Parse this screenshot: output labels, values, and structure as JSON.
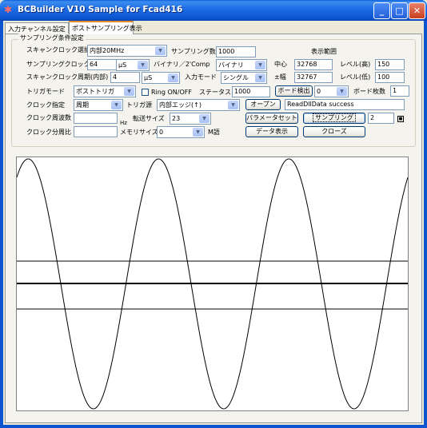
{
  "window": {
    "title": "BCBuilder  V10 Sample  for Fcad416"
  },
  "tabs": [
    {
      "label": "入力チャンネル設定"
    },
    {
      "label": "ポストサンプリング表示"
    }
  ],
  "group": {
    "legend": "サンプリング条件設定"
  },
  "form": {
    "scan_clock_select": {
      "label": "スキャンクロック選択",
      "value": "内部20MHz"
    },
    "sample_count": {
      "label": "サンプリング数",
      "value": "1000"
    },
    "display_range": {
      "label": "表示範囲"
    },
    "sampling_clock": {
      "label": "サンプリングクロック",
      "value": "64",
      "unit": "μS"
    },
    "binary_2comp": {
      "label": "バイナリ／2'Comp",
      "value": "バイナリ"
    },
    "center": {
      "label": "中心",
      "value": "32768"
    },
    "level_high": {
      "label": "レベル(高)",
      "value": "150"
    },
    "scan_clock_period": {
      "label": "スキャンクロック周期(内部)",
      "value": "4",
      "unit": "μS"
    },
    "input_mode": {
      "label": "入力モード",
      "value": "シングル"
    },
    "plus_minus_width": {
      "label": "±幅",
      "value": "32767"
    },
    "level_low": {
      "label": "レベル(低)",
      "value": "100"
    },
    "trigger_mode": {
      "label": "トリガモード",
      "value": "ポストトリガ"
    },
    "ring": {
      "label": "Ring ON/OFF",
      "checked": false
    },
    "status": {
      "label": "ステータス",
      "value": "1000"
    },
    "board_detect": {
      "label": "ボード検出",
      "value": "0"
    },
    "board_count": {
      "label": "ボード枚数",
      "value": "1"
    },
    "clock_spec": {
      "label": "クロック指定",
      "value": "周期"
    },
    "trigger_source": {
      "label": "トリガ源",
      "value": "内部エッジ(↑)"
    },
    "open_button": "オープン",
    "message": "ReadDllData success",
    "clock_freq": {
      "label": "クロック周波数",
      "value": "",
      "unit": "Hz"
    },
    "transfer_size": {
      "label": "転送サイズ",
      "value": "23"
    },
    "param_set_button": "パラメータセット",
    "sampling_button": "サンプリング",
    "sampling_value": "2",
    "sampling_icon": "square-icon",
    "clock_divide": {
      "label": "クロック分周比",
      "value": ""
    },
    "memory_size": {
      "label": "メモリサイズ",
      "value": "0",
      "unit": "M語"
    },
    "data_display_button": "データ表示",
    "close_button": "クローズ"
  },
  "chart_data": {
    "type": "line",
    "series": [
      {
        "waveform": "sine",
        "cycles": 3,
        "phase_start": "peak"
      }
    ],
    "grid": false
  },
  "colors": {
    "title_bar": "#0b55d0",
    "window_bg": "#ece9d8",
    "tab_accent": "#e68b2c"
  }
}
